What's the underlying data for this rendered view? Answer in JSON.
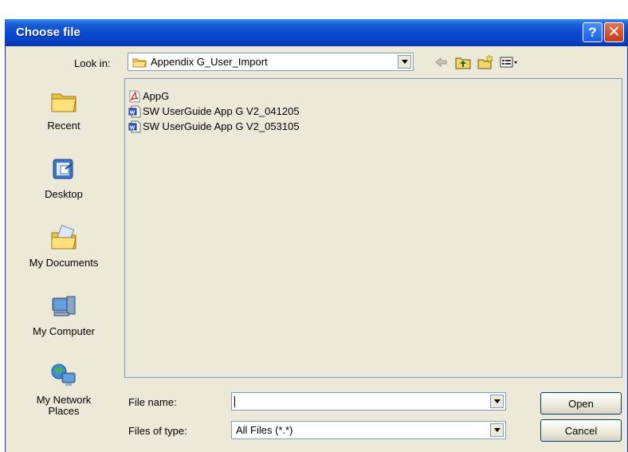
{
  "window": {
    "title": "Choose file"
  },
  "titlebar": {
    "help_glyph": "?",
    "close_glyph": "✕"
  },
  "lookin": {
    "label": "Look in:",
    "value": "Appendix G_User_Import"
  },
  "toolbar": {
    "icons": [
      "back-arrow-icon",
      "up-folder-icon",
      "new-folder-icon",
      "view-menu-icon"
    ]
  },
  "places": [
    {
      "label": "Recent",
      "icon": "recent-folder-icon"
    },
    {
      "label": "Desktop",
      "icon": "desktop-icon"
    },
    {
      "label": "My Documents",
      "icon": "my-documents-icon"
    },
    {
      "label": "My Computer",
      "icon": "my-computer-icon"
    },
    {
      "label": "My Network Places",
      "icon": "network-places-icon"
    }
  ],
  "files": [
    {
      "name": "AppG",
      "icon": "pdf-file-icon"
    },
    {
      "name": "SW UserGuide App G V2_041205",
      "icon": "word-doc-icon"
    },
    {
      "name": "SW UserGuide App G V2_053105",
      "icon": "word-doc-icon"
    }
  ],
  "filename": {
    "label": "File name:",
    "value": ""
  },
  "filetype": {
    "label": "Files of type:",
    "value": "All Files (*.*)"
  },
  "buttons": {
    "open": "Open",
    "cancel": "Cancel"
  },
  "colors": {
    "titlebar": "#0a4bd0",
    "dialog_bg": "#ece9d8",
    "border": "#7f9db9"
  }
}
